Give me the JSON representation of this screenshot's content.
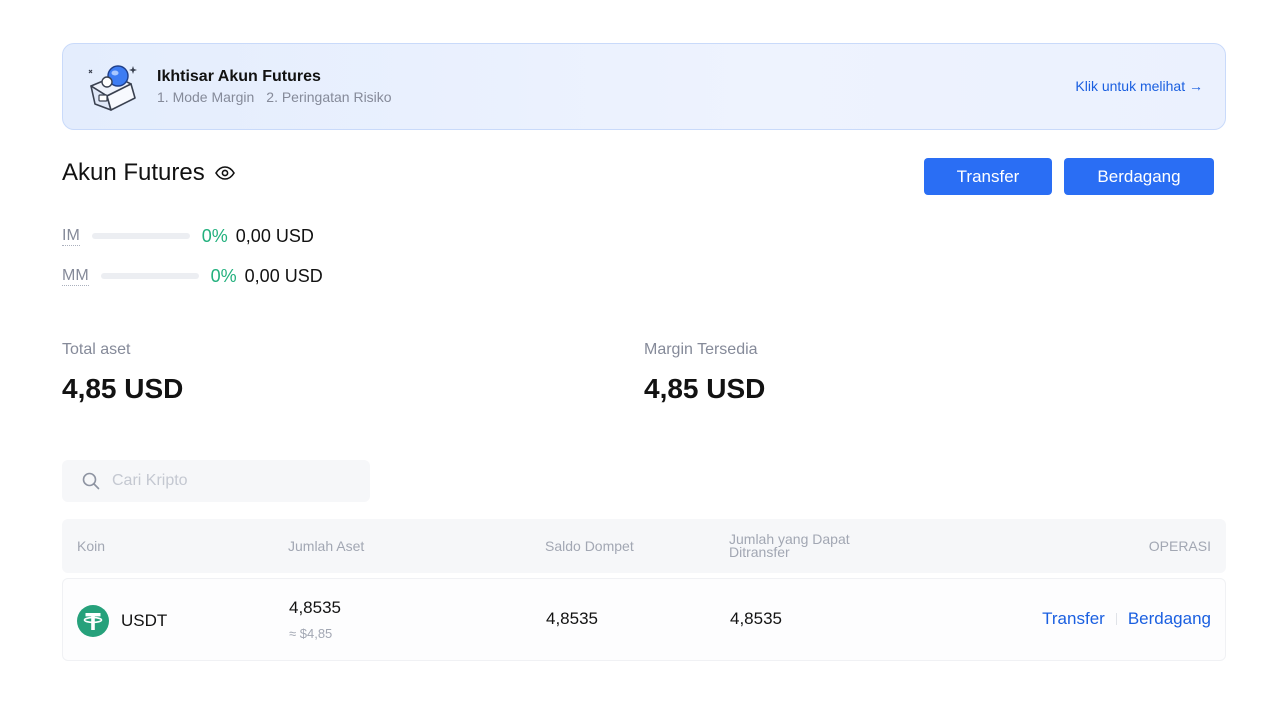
{
  "banner": {
    "title": "Ikhtisar Akun Futures",
    "item1": "1. Mode Margin",
    "item2": "2. Peringatan Risiko",
    "link": "Klik untuk melihat →"
  },
  "account": {
    "title": "Akun Futures",
    "transfer_label": "Transfer",
    "trade_label": "Berdagang"
  },
  "margins": [
    {
      "label": "IM",
      "percent": "0%",
      "fill_fraction": 0,
      "value": "0,00 USD"
    },
    {
      "label": "MM",
      "percent": "0%",
      "fill_fraction": 0,
      "value": "0,00 USD"
    }
  ],
  "stats": {
    "total_label": "Total aset",
    "total_value": "4,85 USD",
    "margin_label": "Margin Tersedia",
    "margin_value": "4,85 USD"
  },
  "search": {
    "placeholder": "Cari Kripto",
    "value": ""
  },
  "table": {
    "headers": {
      "coin": "Koin",
      "amount": "Jumlah Aset",
      "wallet": "Saldo Dompet",
      "transferable_line1": "Jumlah yang Dapat",
      "transferable_line2": "Ditransfer",
      "operation": "OPERASI"
    },
    "rows": [
      {
        "coin": "USDT",
        "amount": "4,8535",
        "amount_usd": "≈ $4,85",
        "wallet": "4,8535",
        "transferable": "4,8535",
        "op_transfer": "Transfer",
        "op_trade": "Berdagang"
      }
    ]
  },
  "colors": {
    "primary": "#2a6ef4",
    "link": "#1a5fe0",
    "positive": "#22b07d",
    "usdt": "#26a17b"
  }
}
